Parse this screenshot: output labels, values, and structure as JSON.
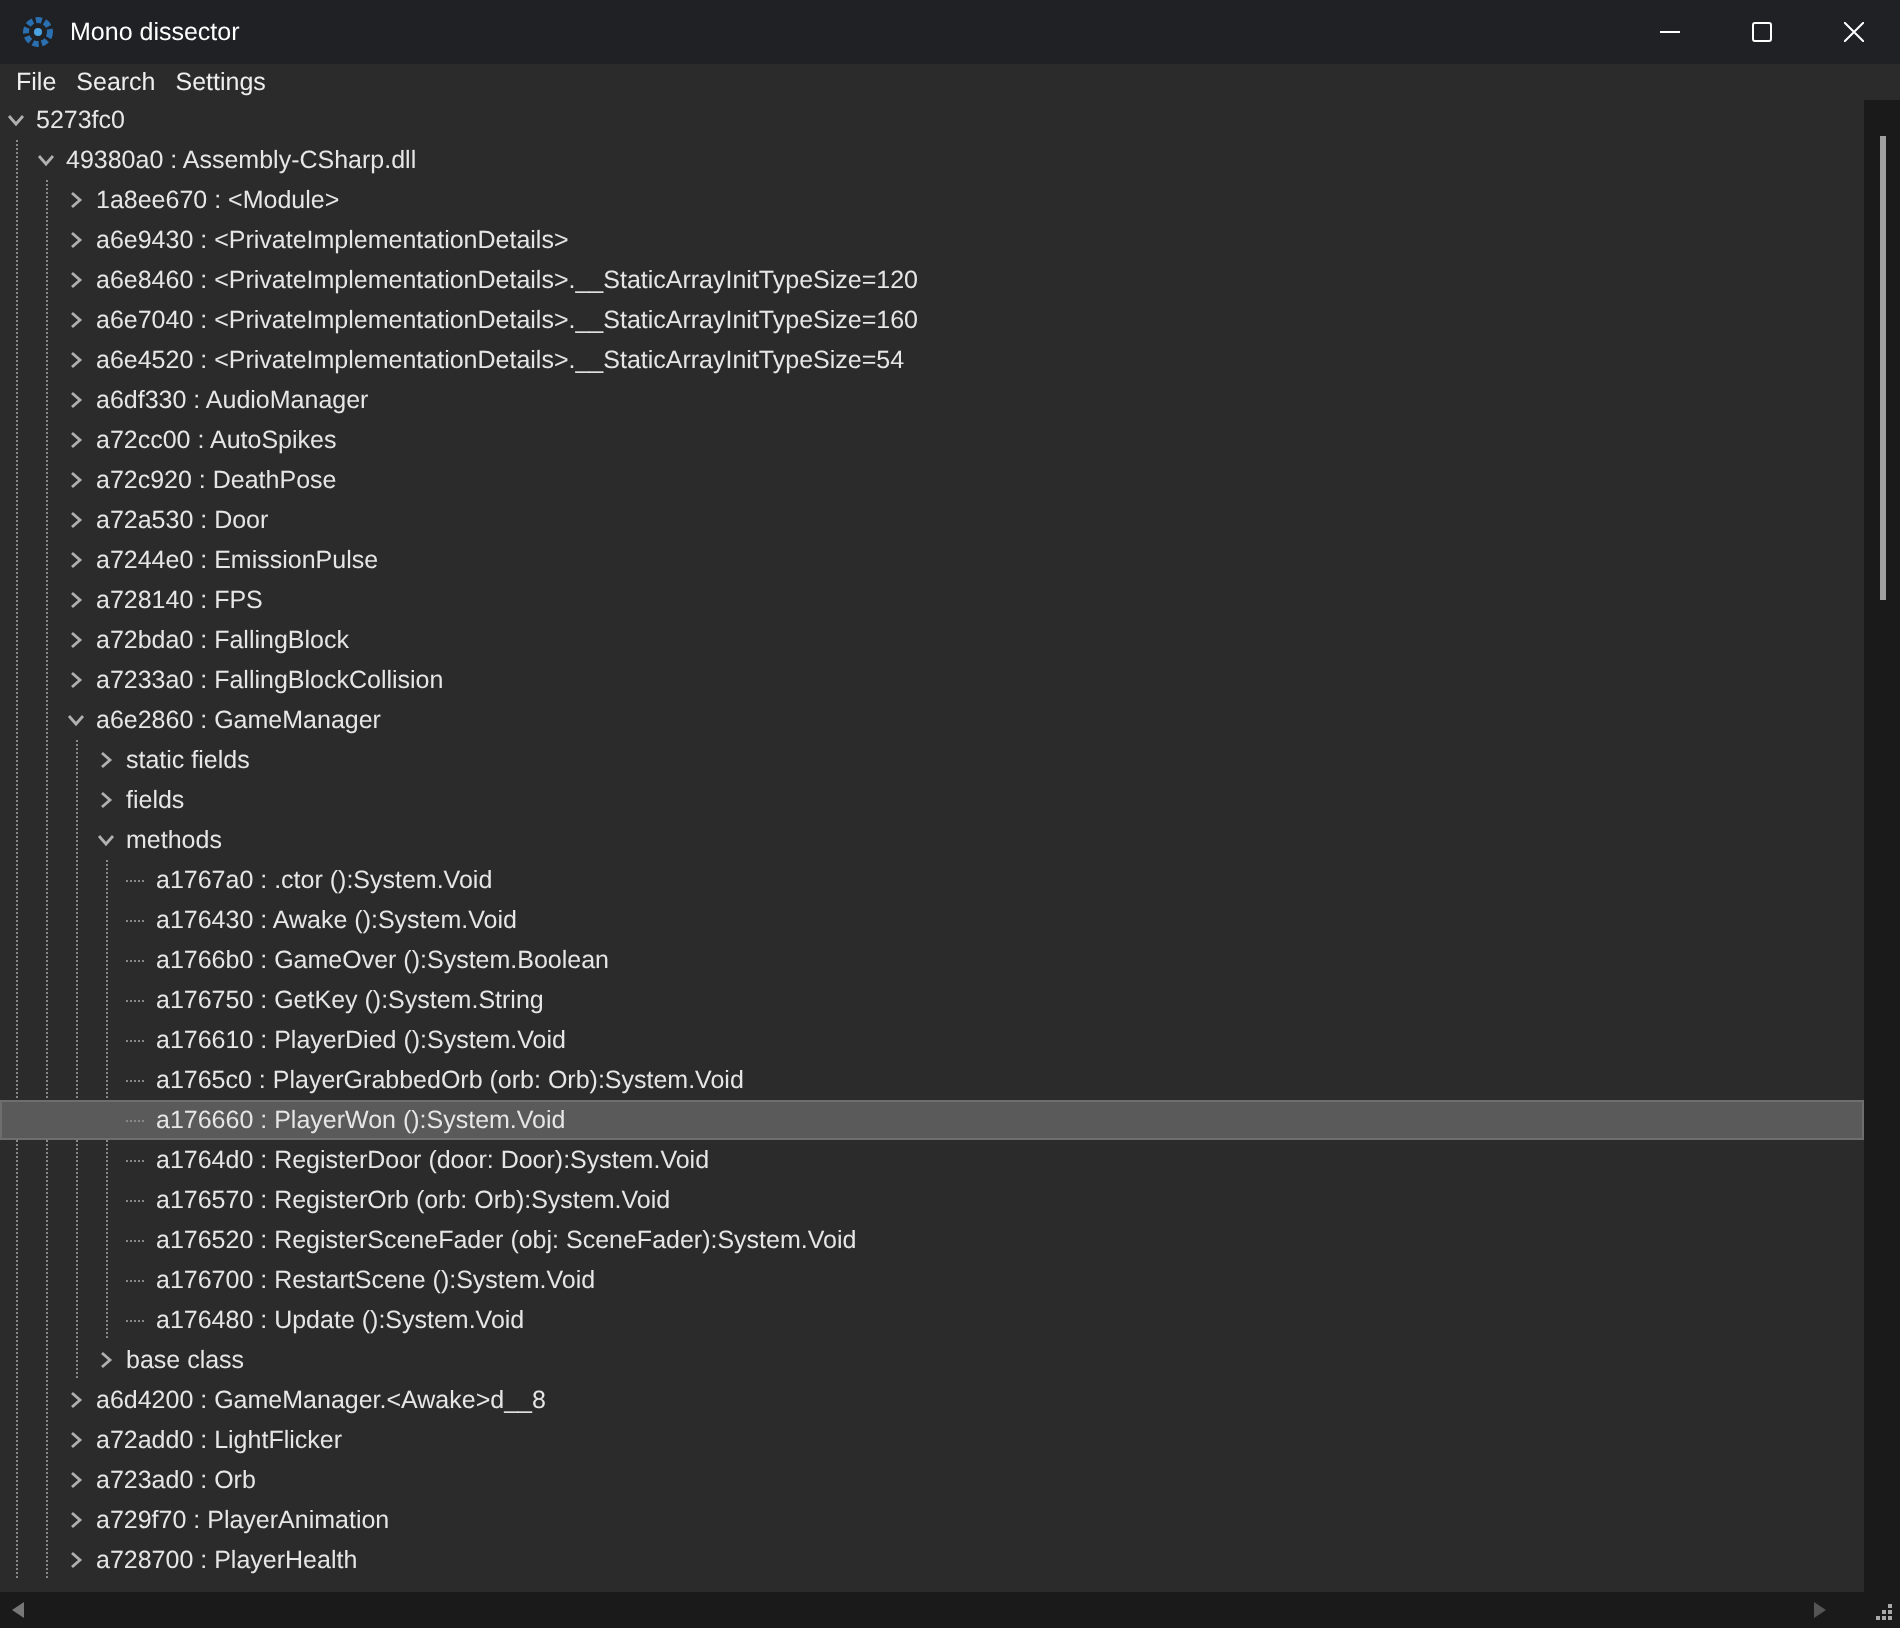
{
  "window": {
    "title": "Mono dissector"
  },
  "menu": [
    "File",
    "Search",
    "Settings"
  ],
  "tree": [
    {
      "label": "5273fc0",
      "expanded": true,
      "selected": false,
      "children": [
        {
          "label": "49380a0 : Assembly-CSharp.dll",
          "expanded": true,
          "selected": false,
          "children": [
            {
              "label": "1a8ee670 : <Module>",
              "expanded": false,
              "selected": false
            },
            {
              "label": "a6e9430 : <PrivateImplementationDetails>",
              "expanded": false,
              "selected": false
            },
            {
              "label": "a6e8460 : <PrivateImplementationDetails>.__StaticArrayInitTypeSize=120",
              "expanded": false,
              "selected": false
            },
            {
              "label": "a6e7040 : <PrivateImplementationDetails>.__StaticArrayInitTypeSize=160",
              "expanded": false,
              "selected": false
            },
            {
              "label": "a6e4520 : <PrivateImplementationDetails>.__StaticArrayInitTypeSize=54",
              "expanded": false,
              "selected": false
            },
            {
              "label": "a6df330 : AudioManager",
              "expanded": false,
              "selected": false
            },
            {
              "label": "a72cc00 : AutoSpikes",
              "expanded": false,
              "selected": false
            },
            {
              "label": "a72c920 : DeathPose",
              "expanded": false,
              "selected": false
            },
            {
              "label": "a72a530 : Door",
              "expanded": false,
              "selected": false
            },
            {
              "label": "a7244e0 : EmissionPulse",
              "expanded": false,
              "selected": false
            },
            {
              "label": "a728140 : FPS",
              "expanded": false,
              "selected": false
            },
            {
              "label": "a72bda0 : FallingBlock",
              "expanded": false,
              "selected": false
            },
            {
              "label": "a7233a0 : FallingBlockCollision",
              "expanded": false,
              "selected": false
            },
            {
              "label": "a6e2860 : GameManager",
              "expanded": true,
              "selected": false,
              "children": [
                {
                  "label": "static fields",
                  "expanded": false,
                  "selected": false
                },
                {
                  "label": "fields",
                  "expanded": false,
                  "selected": false
                },
                {
                  "label": "methods",
                  "expanded": true,
                  "selected": false,
                  "children": [
                    {
                      "label": "a1767a0 : .ctor ():System.Void",
                      "selected": false
                    },
                    {
                      "label": "a176430 : Awake ():System.Void",
                      "selected": false
                    },
                    {
                      "label": "a1766b0 : GameOver ():System.Boolean",
                      "selected": false
                    },
                    {
                      "label": "a176750 : GetKey ():System.String",
                      "selected": false
                    },
                    {
                      "label": "a176610 : PlayerDied ():System.Void",
                      "selected": false
                    },
                    {
                      "label": "a1765c0 : PlayerGrabbedOrb (orb: Orb):System.Void",
                      "selected": false
                    },
                    {
                      "label": "a176660 : PlayerWon ():System.Void",
                      "selected": true
                    },
                    {
                      "label": "a1764d0 : RegisterDoor (door: Door):System.Void",
                      "selected": false
                    },
                    {
                      "label": "a176570 : RegisterOrb (orb: Orb):System.Void",
                      "selected": false
                    },
                    {
                      "label": "a176520 : RegisterSceneFader (obj: SceneFader):System.Void",
                      "selected": false
                    },
                    {
                      "label": "a176700 : RestartScene ():System.Void",
                      "selected": false
                    },
                    {
                      "label": "a176480 : Update ():System.Void",
                      "selected": false
                    }
                  ]
                },
                {
                  "label": "base class",
                  "expanded": false,
                  "selected": false
                }
              ]
            },
            {
              "label": "a6d4200 : GameManager.<Awake>d__8",
              "expanded": false,
              "selected": false
            },
            {
              "label": "a72add0 : LightFlicker",
              "expanded": false,
              "selected": false
            },
            {
              "label": "a723ad0 : Orb",
              "expanded": false,
              "selected": false
            },
            {
              "label": "a729f70 : PlayerAnimation",
              "expanded": false,
              "selected": false
            },
            {
              "label": "a728700 : PlayerHealth",
              "expanded": false,
              "selected": false
            }
          ]
        }
      ]
    }
  ]
}
